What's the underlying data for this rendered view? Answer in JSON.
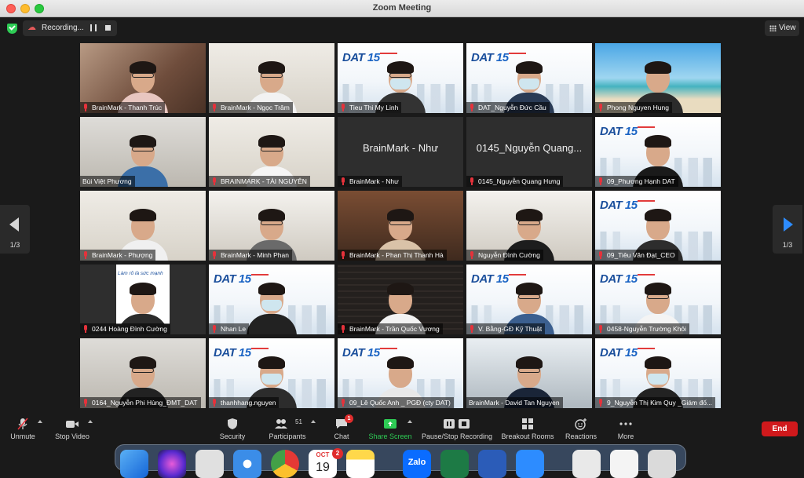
{
  "window": {
    "title": "Zoom Meeting"
  },
  "topbar": {
    "recording_label": "Recording...",
    "view_label": "View"
  },
  "pagination": {
    "left": "1/3",
    "right": "1/3"
  },
  "tiles": [
    {
      "name": "BrainMark - Thanh Trúc",
      "muted": true
    },
    {
      "name": "BrainMark - Ngọc Trâm",
      "muted": true
    },
    {
      "name": "Tieu Thi My Linh",
      "muted": true
    },
    {
      "name": "DAT_Nguyễn Đức Cầu",
      "muted": true
    },
    {
      "name": "Phong Nguyen Hung",
      "muted": true
    },
    {
      "name": "Bùi Việt Phương",
      "muted": false
    },
    {
      "name": "BRAINMARK - TÀI NGUYÊN",
      "muted": true
    },
    {
      "name": "BrainMark - Như",
      "muted": true,
      "display_name": "BrainMark - Như"
    },
    {
      "name": "0145_Nguyễn Quang Hưng",
      "muted": true,
      "display_name": "0145_Nguyễn Quang..."
    },
    {
      "name": "09_Phương Hạnh DAT",
      "muted": true
    },
    {
      "name": "BrainMark - Phượng",
      "muted": true
    },
    {
      "name": "BrainMark - Minh Phan",
      "muted": true
    },
    {
      "name": "BrainMark - Phan Thị Thanh Hà",
      "muted": true
    },
    {
      "name": "Nguyễn Đình Cường",
      "muted": true
    },
    {
      "name": "09_Tiêu Văn Đạt_CEO",
      "muted": true,
      "active": true
    },
    {
      "name": "0244 Hoàng Đình Cường",
      "muted": true,
      "banner": "Làm rõ là sức mạnh"
    },
    {
      "name": "Nhan Le",
      "muted": true
    },
    {
      "name": "BrainMark - Trần Quốc Vương",
      "muted": true
    },
    {
      "name": "V. Bằng-GĐ Kỹ Thuật",
      "muted": true
    },
    {
      "name": "0458-Nguyễn Trường Khôi",
      "muted": true
    },
    {
      "name": "0164_Nguyễn Phi Hùng_ĐMT_DAT",
      "muted": true
    },
    {
      "name": "thanhhang.nguyen",
      "muted": true
    },
    {
      "name": "09_Lê Quốc Anh _ PGĐ (cty DAT)",
      "muted": true
    },
    {
      "name": "BrainMark - David Tan Nguyen",
      "muted": false
    },
    {
      "name": "9_Nguyễn Thị Kim Quy _Giám đố...",
      "muted": true
    }
  ],
  "dat_logo": {
    "brand": "DAT",
    "years": "15"
  },
  "toolbar": {
    "unmute": "Unmute",
    "stop_video": "Stop Video",
    "security": "Security",
    "participants": "Participants",
    "participants_count": "51",
    "chat": "Chat",
    "chat_badge": "1",
    "share_screen": "Share Screen",
    "pause_recording": "Pause/Stop Recording",
    "breakout_rooms": "Breakout Rooms",
    "reactions": "Reactions",
    "more": "More",
    "end": "End"
  },
  "dock": {
    "calendar_month": "OCT",
    "calendar_day": "19",
    "calendar_badge": "2",
    "zalo": "Zalo"
  },
  "colors": {
    "accent": "#2d8cff",
    "end": "#d0191c",
    "share": "#2ecc55",
    "active_speaker": "#9ad23a",
    "mic_muted": "#e5323b"
  }
}
